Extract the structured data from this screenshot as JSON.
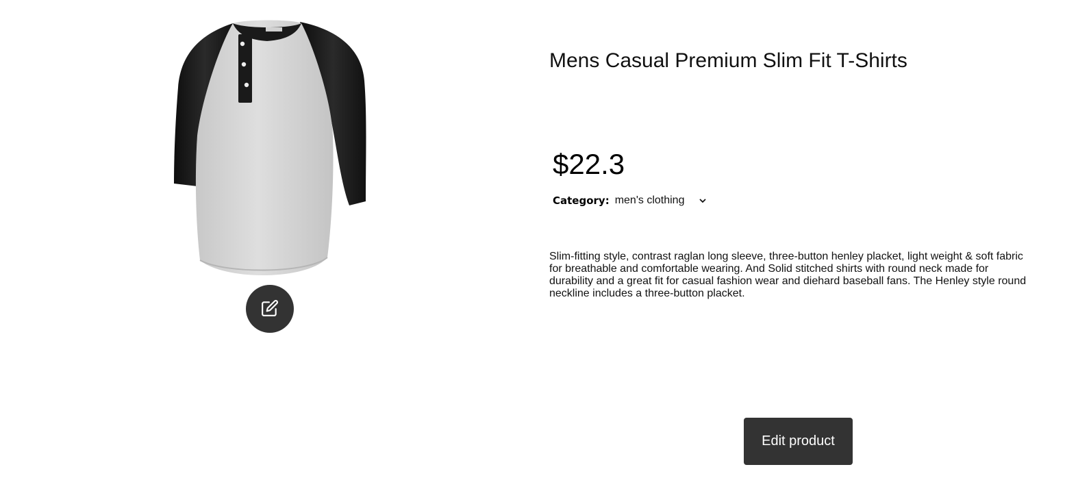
{
  "product": {
    "title": "Mens Casual Premium Slim Fit T-Shirts",
    "price": "$22.3",
    "category_label": "Category:",
    "category_value": "men's clothing",
    "description": "Slim-fitting style, contrast raglan long sleeve, three-button henley placket, light weight & soft fabric for breathable and comfortable wearing. And Solid stitched shirts with round neck made for durability and a great fit for casual fashion wear and diehard baseball fans. The Henley style round neckline includes a three-button placket.",
    "image_icon": "edit-pencil-icon"
  },
  "actions": {
    "edit_product_label": "Edit product"
  },
  "colors": {
    "button_bg": "#333333",
    "button_text": "#ffffff",
    "shirt_body": "#d9d9d9",
    "shirt_sleeves": "#1a1a1a"
  }
}
